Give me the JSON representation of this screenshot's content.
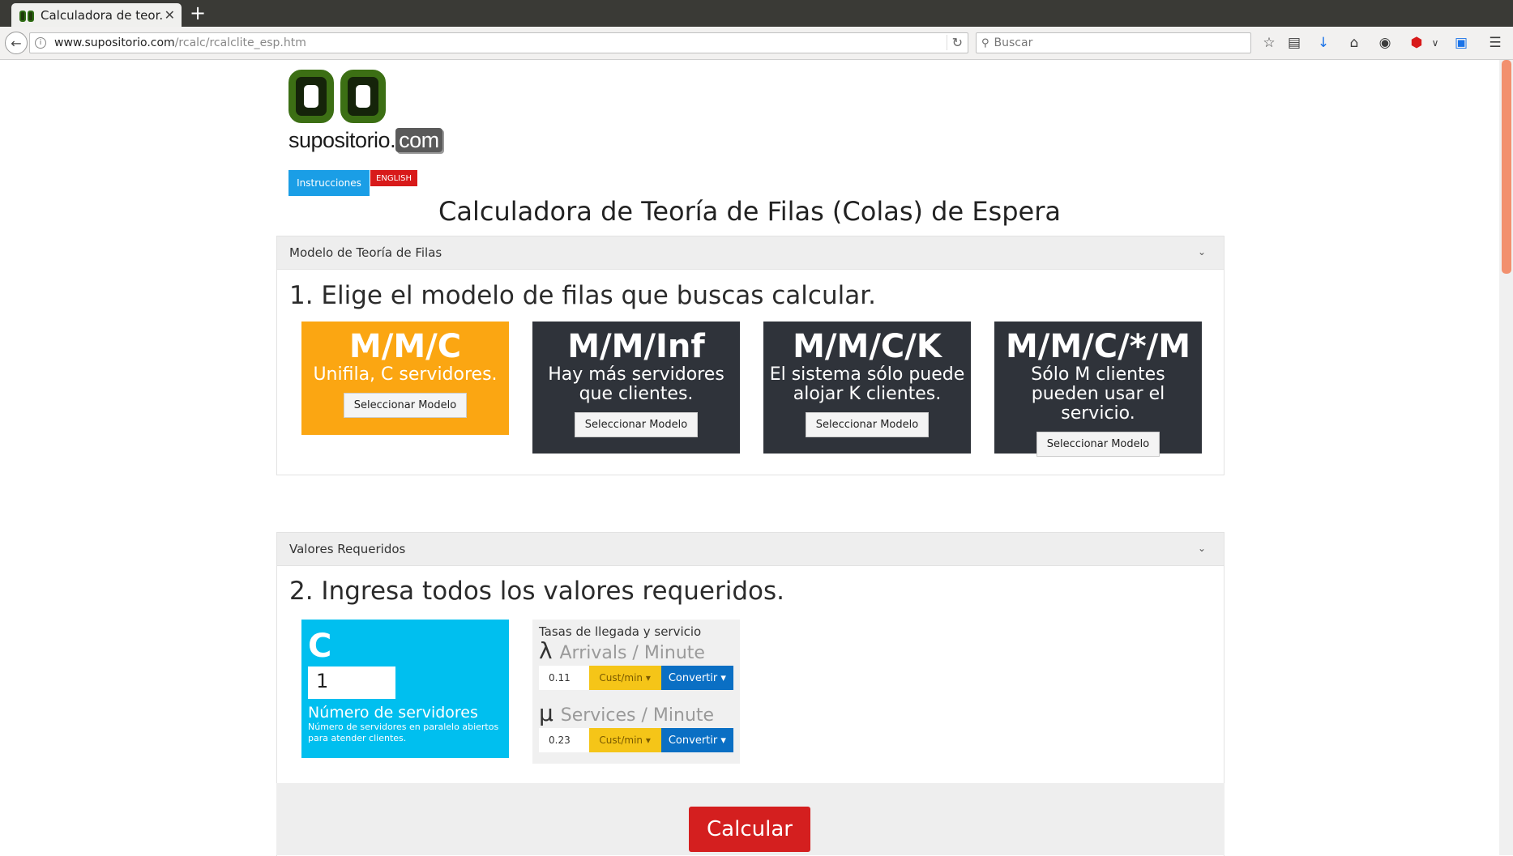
{
  "browser": {
    "tab_title": "Calculadora de teor...",
    "tab_close": "✕",
    "new_tab": "+",
    "url_host": "www.supositorio.com",
    "url_path": "/rcalc/rcalclite_esp.htm",
    "search_placeholder": "Buscar"
  },
  "header": {
    "logo_text": "supositorio.",
    "logo_com": "com",
    "instructions_label": "Instrucciones",
    "english_label": "ENGLISH"
  },
  "page_title": "Calculadora de Teoría de Filas (Colas) de Espera",
  "model_panel": {
    "heading": "Modelo de Teoría de Filas",
    "step_title": "1. Elige el modelo de filas que buscas calcular.",
    "models": [
      {
        "code": "M/M/C",
        "desc": "Unifila, C servidores.",
        "button": "Seleccionar Modelo",
        "color": "#fba612"
      },
      {
        "code": "M/M/Inf",
        "desc": "Hay más servidores que clientes.",
        "button": "Seleccionar Modelo",
        "color": "#2f333a"
      },
      {
        "code": "M/M/C/K",
        "desc": "El sistema sólo puede alojar K clientes.",
        "button": "Seleccionar Modelo",
        "color": "#2f333a"
      },
      {
        "code": "M/M/C/*/M",
        "desc": "Sólo M clientes pueden usar el servicio.",
        "button": "Seleccionar Modelo",
        "color": "#2f333a"
      }
    ]
  },
  "values_panel": {
    "heading": "Valores Requeridos",
    "step_title": "2. Ingresa todos los valores requeridos.",
    "servers": {
      "letter": "C",
      "value": "1",
      "label": "Número de servidores",
      "help": "Número de servidores en paralelo abiertos para atender clientes."
    },
    "rates": {
      "heading": "Tasas de llegada y servicio",
      "arrival_symbol": "λ",
      "arrival_unit": "Arrivals / Minute",
      "arrival_value": "0.11",
      "service_symbol": "μ",
      "service_unit": "Services / Minute",
      "service_value": "0.23",
      "cust_label": "Cust/min",
      "convert_label": "Convertir"
    }
  },
  "calc_button": "Calcular"
}
